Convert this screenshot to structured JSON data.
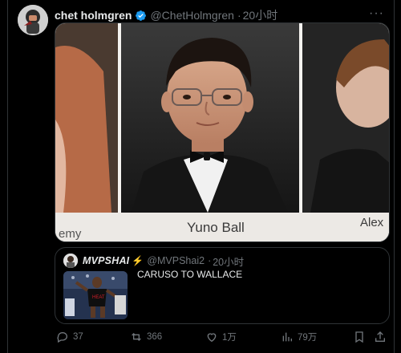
{
  "tweet": {
    "author_name": "chet holmgren",
    "author_handle": "@ChetHolmgren",
    "time": "20小时",
    "more_icon": "more-horizontal-icon",
    "verified_icon": "verified-badge-icon"
  },
  "photo": {
    "nameplate_center": "Yuno Ball",
    "nameplate_left": "emy",
    "nameplate_right": "Alex"
  },
  "quote": {
    "author_name": "MVPSHAI",
    "author_handle": "@MVPShai2",
    "time": "20小时",
    "text": "CARUSO TO WALLACE",
    "badge_icon": "lightning-icon"
  },
  "actions": {
    "replies": "37",
    "reposts": "366",
    "likes": "1万",
    "views": "79万"
  },
  "colors": {
    "background": "#000000",
    "text": "#e7e9ea",
    "muted": "#71767b",
    "verified": "#1d9bf0",
    "border": "#2f3336"
  }
}
